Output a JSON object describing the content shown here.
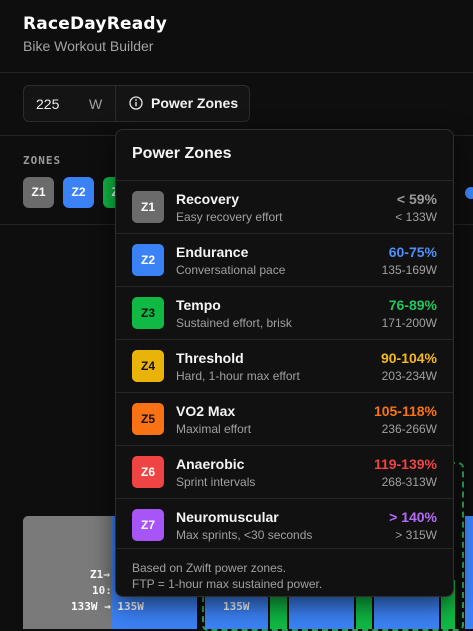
{
  "app": {
    "logo": "RaceDayReady",
    "subtitle": "Bike Workout Builder"
  },
  "toolbar": {
    "ftp_value": "225",
    "ftp_unit": "W",
    "power_zones_label": "Power Zones"
  },
  "zones_section": {
    "label": "ZONES",
    "chips": [
      "Z1",
      "Z2",
      "Z3"
    ]
  },
  "chart_text": {
    "line1": "Z1→",
    "line2": "10:",
    "line3": "133W → 135W",
    "line4": "135W"
  },
  "popover": {
    "title": "Power Zones",
    "zones": [
      {
        "id": "Z1",
        "name": "Recovery",
        "desc": "Easy recovery effort",
        "pct": "< 59%",
        "watts": "< 133W",
        "color": "#6b6b6b",
        "pct_color": "#9a9a9a",
        "text_color": "#ffffff"
      },
      {
        "id": "Z2",
        "name": "Endurance",
        "desc": "Conversational pace",
        "pct": "60-75%",
        "watts": "135-169W",
        "color": "#3b82f6",
        "pct_color": "#4f8ff7",
        "text_color": "#ffffff"
      },
      {
        "id": "Z3",
        "name": "Tempo",
        "desc": "Sustained effort, brisk",
        "pct": "76-89%",
        "watts": "171-200W",
        "color": "#10b944",
        "pct_color": "#22c55e",
        "text_color": "#111111"
      },
      {
        "id": "Z4",
        "name": "Threshold",
        "desc": "Hard, 1-hour max effort",
        "pct": "90-104%",
        "watts": "203-234W",
        "color": "#eab308",
        "pct_color": "#f5b820",
        "text_color": "#111111"
      },
      {
        "id": "Z5",
        "name": "VO2 Max",
        "desc": "Maximal effort",
        "pct": "105-118%",
        "watts": "236-266W",
        "color": "#f97316",
        "pct_color": "#f97316",
        "text_color": "#111111"
      },
      {
        "id": "Z6",
        "name": "Anaerobic",
        "desc": "Sprint intervals",
        "pct": "119-139%",
        "watts": "268-313W",
        "color": "#ef4444",
        "pct_color": "#ef4444",
        "text_color": "#ffffff"
      },
      {
        "id": "Z7",
        "name": "Neuromuscular",
        "desc": "Max sprints, <30 seconds",
        "pct": "> 140%",
        "watts": "> 315W",
        "color": "#a855f7",
        "pct_color": "#b46cf8",
        "text_color": "#ffffff"
      }
    ],
    "footnote_line1": "Based on Zwift power zones.",
    "footnote_line2": "FTP = 1-hour max sustained power."
  }
}
